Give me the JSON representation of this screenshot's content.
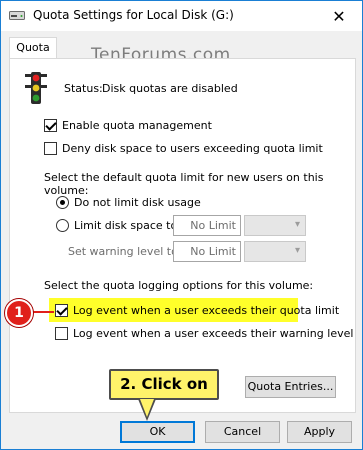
{
  "window": {
    "title": "Quota Settings for Local Disk (G:)",
    "close_glyph": "✕",
    "accent_color": "#0078d7"
  },
  "tabs": [
    {
      "label": "Quota",
      "selected": true
    }
  ],
  "watermark": "TenForums.com",
  "status": {
    "label": "Status:",
    "value": "Disk quotas are disabled"
  },
  "options": {
    "enable_quota": {
      "label": "Enable quota management",
      "checked": true
    },
    "deny_space": {
      "label": "Deny disk space to users exceeding quota limit",
      "checked": false
    }
  },
  "default_limit": {
    "heading": "Select the default quota limit for new users on this volume:",
    "do_not_limit": {
      "label": "Do not limit disk usage",
      "selected": true
    },
    "limit_to": {
      "label": "Limit disk space to",
      "value": "No Limit",
      "selected": false
    },
    "warning_level": {
      "label": "Set warning level to",
      "value": "No Limit"
    }
  },
  "logging": {
    "heading": "Select the quota logging options for this volume:",
    "log_limit": {
      "label": "Log event when a user exceeds their quota limit",
      "checked": true,
      "highlight_color": "#ffff2a"
    },
    "log_warning": {
      "label": "Log event when a user exceeds their warning level",
      "checked": false
    }
  },
  "annotations": {
    "step1_badge": "1",
    "step2_callout": "2. Click on",
    "badge_color": "#e0201b",
    "callout_color": "#fff36a"
  },
  "buttons": {
    "quota_entries": "Quota Entries...",
    "ok": "OK",
    "cancel": "Cancel",
    "apply": "Apply"
  }
}
